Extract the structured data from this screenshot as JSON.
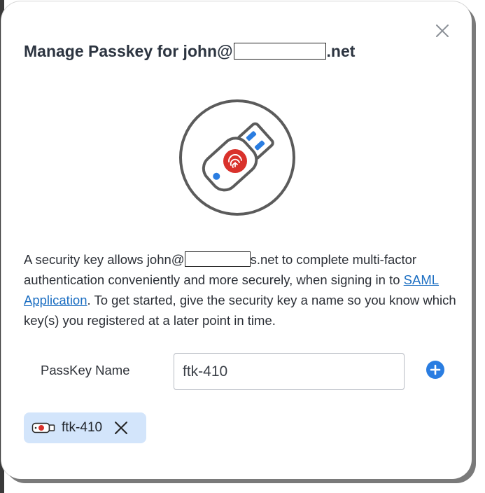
{
  "dialog": {
    "title_prefix": "Manage Passkey for john@",
    "title_suffix": ".net",
    "close_icon": "close-icon",
    "hero_icon": "usb-security-key-fingerprint-icon",
    "description": {
      "part1": "A security key allows john@",
      "part2": "s.net to complete multi-factor authentication conveniently and more securely, when signing in to ",
      "link_text": "SAML Application",
      "part3": ". To get started, give the security key a name so you know which key(s) you registered at a later point in time."
    },
    "field_label": "PassKey Name",
    "input_value": "ftk-410",
    "add_icon": "plus-circle-icon",
    "chips": [
      {
        "label": "ftk-410",
        "icon": "usb-key-icon",
        "remove_icon": "close-icon"
      }
    ]
  },
  "colors": {
    "accent": "#2a7de1",
    "link": "#1b6ec2",
    "chip_bg": "#d3e5fb",
    "fingerprint_red": "#d9312b",
    "title_text": "#2c3440"
  }
}
